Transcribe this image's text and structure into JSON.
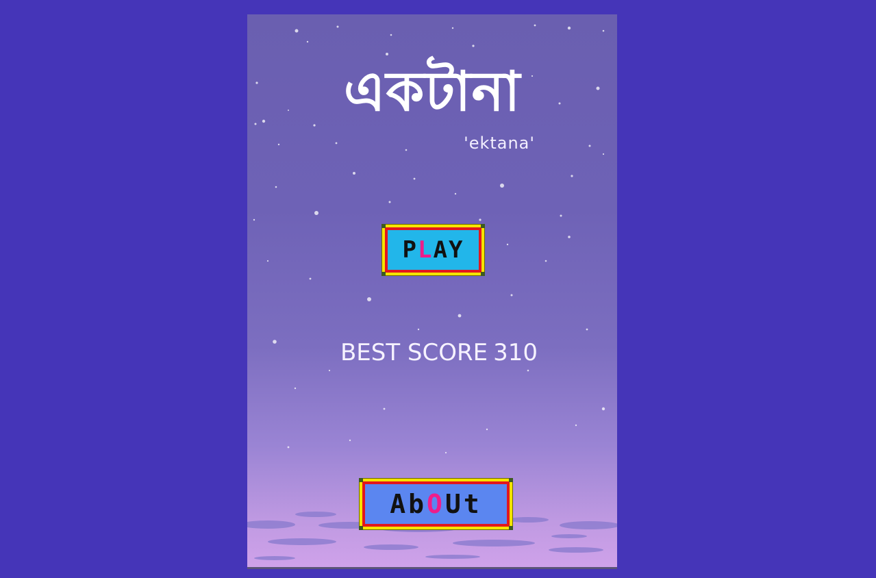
{
  "title": "একটানা",
  "subtitle": "'ektana'",
  "play_button": {
    "label_first": "P",
    "label_accent": "L",
    "label_rest": "AY"
  },
  "best_score": {
    "label": "BEST SCORE",
    "value": "310"
  },
  "about_button": {
    "label_first": "Ab",
    "label_accent": "O",
    "label_rest": "Ut"
  },
  "colors": {
    "page_background": "#4535b8",
    "sky_top": "#6a5fb0",
    "sky_bottom": "#cfa2ea",
    "button_frame": "#f5e400",
    "button_border": "#e2171d",
    "play_fill": "#22b6ea",
    "about_fill": "#5b86f0",
    "accent_letter": "#ee1d8a"
  }
}
